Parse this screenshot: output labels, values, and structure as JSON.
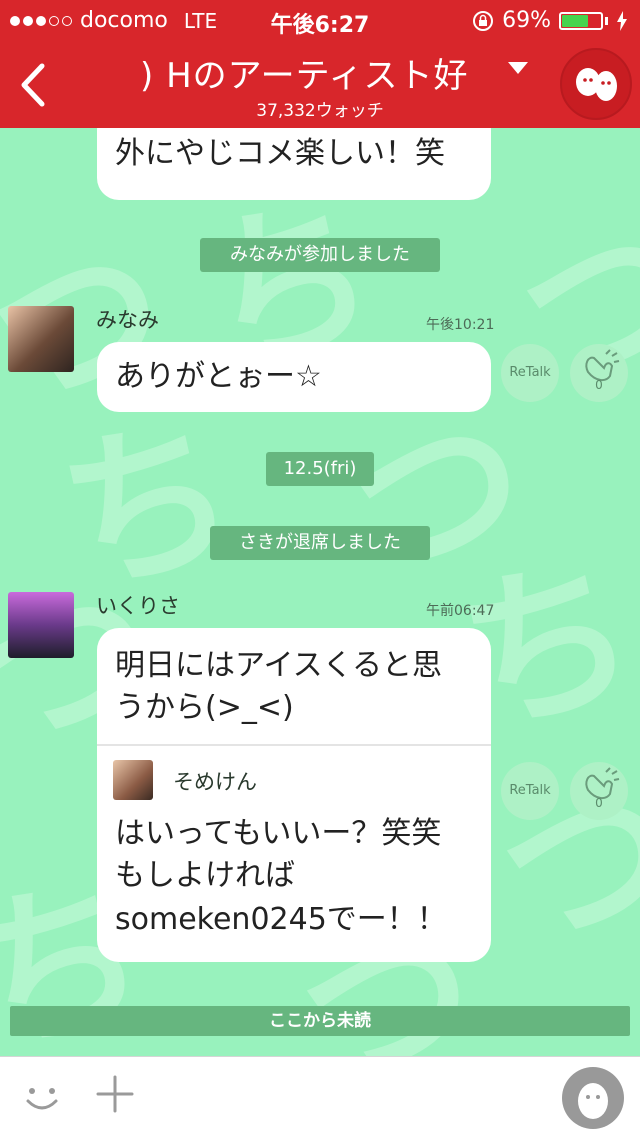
{
  "status_bar": {
    "carrier": "docomo",
    "network": "LTE",
    "time": "午後6:27",
    "battery": "69%",
    "battery_level": 0.69
  },
  "header": {
    "title": ") Hのアーティスト好",
    "watch_count": "37,332ウォッチ"
  },
  "system_messages": {
    "joined": "みなみが参加しました",
    "date": "12.5(fri)",
    "left": "さきが退席しました"
  },
  "messages": [
    {
      "text": "外にやじコメ楽しい！笑"
    },
    {
      "name": "みなみ",
      "time": "午後10:21",
      "text": "ありがとぉー☆",
      "retalk": "ReTalk",
      "claps": "0"
    },
    {
      "name": "いくりさ",
      "time": "午前06:47",
      "text_line1": "明日にはアイスくると思",
      "text_line2": "うから(>_<)",
      "quote": {
        "name": "そめけん",
        "line1": "はいってもいいー？笑笑",
        "line2": "もしよければ",
        "line3": "someken0245でー！！"
      },
      "retalk": "ReTalk",
      "claps": "0"
    }
  ],
  "unread_label": "ここから未読",
  "icons": [
    "back-arrow-icon",
    "dropdown-caret-icon",
    "smiley-icon",
    "plus-icon",
    "clap-icon",
    "lock-rotation-icon",
    "charging-icon"
  ],
  "colors": {
    "header": "#d8262b",
    "background": "#98f2bd",
    "pill": "#66b67f"
  }
}
